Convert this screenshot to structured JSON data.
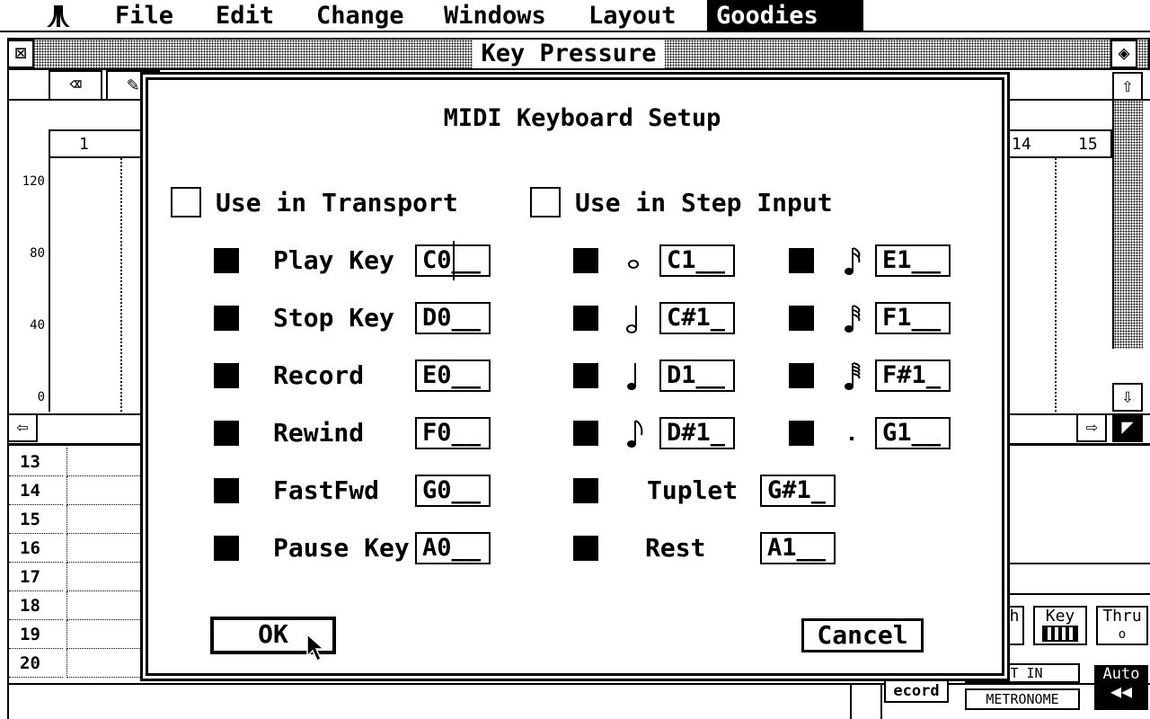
{
  "menubar": {
    "items": [
      "File",
      "Edit",
      "Change",
      "Windows",
      "Layout",
      "Goodies"
    ],
    "active": "Goodies"
  },
  "window": {
    "title": "Key Pressure",
    "ruler_start": "1",
    "ruler_end_a": "14",
    "ruler_end_b": "15",
    "y_labels": [
      "120",
      "80",
      "40",
      "0"
    ],
    "rows": [
      "13",
      "14",
      "15",
      "16",
      "17",
      "18",
      "19",
      "20"
    ],
    "bottom_buttons": {
      "key": "Key",
      "thru": "Thru",
      "thru_sub": "o",
      "record": "ecord",
      "count_in": "NT IN",
      "metronome": "METRONOME",
      "auto": "Auto"
    }
  },
  "dialog": {
    "title": "MIDI Keyboard Setup",
    "transport_checkbox_label": "Use in Transport",
    "step_checkbox_label": "Use in Step Input",
    "transport": [
      {
        "label": "Play Key",
        "value": "C0__"
      },
      {
        "label": "Stop Key",
        "value": "D0__"
      },
      {
        "label": "Record",
        "value": "E0__"
      },
      {
        "label": "Rewind",
        "value": "F0__"
      },
      {
        "label": "FastFwd",
        "value": "G0__"
      },
      {
        "label": "Pause Key",
        "value": "A0__"
      }
    ],
    "step_col1": [
      {
        "note": "whole-note",
        "value": "C1__"
      },
      {
        "note": "half-note",
        "value": "C#1_"
      },
      {
        "note": "quarter-note",
        "value": "D1__"
      },
      {
        "note": "eighth-note",
        "value": "D#1_"
      }
    ],
    "step_col2": [
      {
        "note": "sixteenth-note",
        "value": "E1__"
      },
      {
        "note": "thirty-second-note",
        "value": "F1__"
      },
      {
        "note": "sixty-fourth-note",
        "value": "F#1_"
      },
      {
        "note": "dot",
        "value": "G1__"
      }
    ],
    "tuplet": {
      "label": "Tuplet",
      "value": "G#1_"
    },
    "rest": {
      "label": "Rest",
      "value": "A1__"
    },
    "ok_label": "OK",
    "cancel_label": "Cancel"
  }
}
